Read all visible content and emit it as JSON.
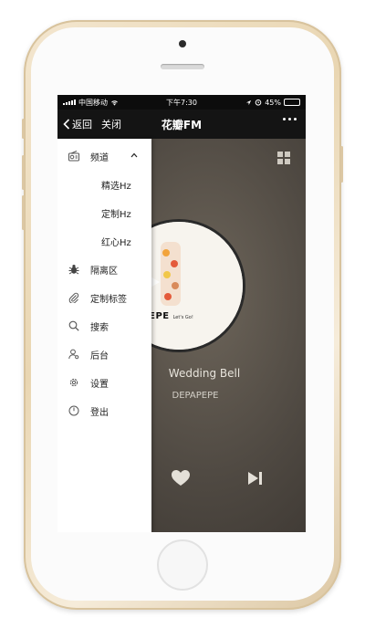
{
  "status": {
    "carrier": "中国移动",
    "time": "下午7:30",
    "battery": "45%",
    "battery_level": 0.45
  },
  "nav": {
    "back_label": "返回",
    "close_label": "关闭",
    "title": "花瓣FM"
  },
  "player": {
    "song_title": "Wedding Bell",
    "artist": "DEPAPEPE",
    "album_text": "DEPAPEPE",
    "album_subtext": "Let's Go!"
  },
  "drawer": {
    "channel": "频道",
    "sub_items": [
      "精选Hz",
      "定制Hz",
      "红心Hz"
    ],
    "items": [
      "隔离区",
      "定制标签",
      "搜索",
      "后台",
      "设置",
      "登出"
    ]
  },
  "colors": {
    "phone_gold": "#e9d6b2",
    "screen_bg": "#4f4942",
    "drawer_bg": "#ffffff",
    "text_dark": "#222222"
  }
}
